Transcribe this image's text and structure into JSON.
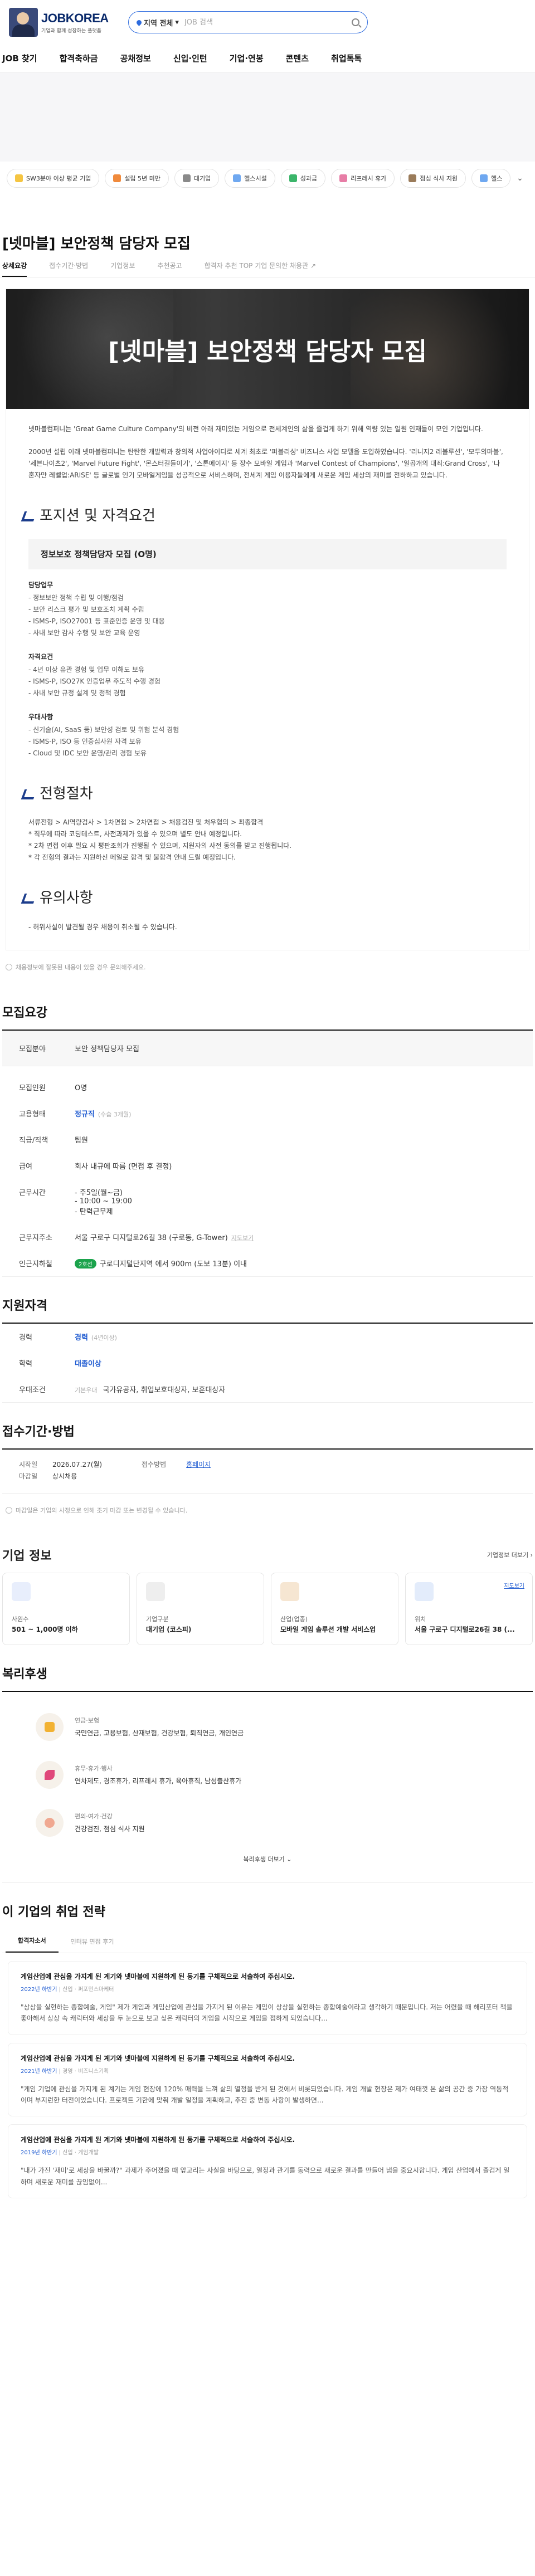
{
  "header": {
    "brand": "JOBKOREA",
    "tagline": "기업과 함께 성장하는 플랫폼",
    "search_location": "지역 전체",
    "search_placeholder": "JOB 검색"
  },
  "nav": [
    "JOB 찾기",
    "합격축하금",
    "공채정보",
    "신입·인턴",
    "기업·연봉",
    "콘텐츠",
    "취업톡톡"
  ],
  "pills": [
    "SW3분야 이상 평균 기업",
    "설립 5년 미만",
    "대기업",
    "헬스시설",
    "성과급",
    "리프레시 휴가",
    "점심 식사 지원",
    "헬스"
  ],
  "job": {
    "title": "[넷마블] 보안정책 담당자 모집",
    "tabs": [
      "상세요강",
      "접수기간·방법",
      "기업정보",
      "추천공고",
      "합격자 추천 TOP 기업 문의한 채용관"
    ],
    "poster": {
      "hero": "[넷마블] 보안정책 담당자 모집",
      "intro": "넷마블컴퍼니는 'Great Game Culture Company'의 비전 아래 재미있는 게임으로 전세계인의 삶을 즐겁게 하기 위해 역량 있는 일원 인재들이 모인 기업입니다.",
      "intro2": "2000년 설립 이래 넷마블컴퍼니는 탄탄한 개발력과 창의적 사업아이디로 세계 최초로 '퍼블리싱' 비즈니스 사업 모델을 도입하였습니다. '리니지2 레볼루션', '모두의마블', '세븐나이츠2', 'Marvel Future Fight', '몬스터길들이기', '스톤에이지' 등 장수 모바일 게임과 'Marvel Contest of Champions', '일곱개의 대죄:Grand Cross', '나 혼자만 레벨업:ARISE' 등 글로벌 인기 모바일게임을 성공적으로 서비스하며, 전세계 게임 이용자들에게 새로운 게임 세상의 재미를 전하하고 있습니다.",
      "sec1": "포지션 및 자격요건",
      "role": "정보보호 정책담당자 모집 (O명)",
      "duties_h": "담당업무",
      "duties": [
        "- 정보보안 정책 수립 및 이행/점검",
        "- 보안 리스크 평가 및 보호조치 계획 수립",
        "- ISMS-P, ISO27001 등 표준인증 운영 및 대응",
        "- 사내 보안 감사 수행 및 보안 교육 운영"
      ],
      "req_h": "자격요건",
      "req": [
        "- 4년 이상 유관 경험 및 업무 이해도 보유",
        "- ISMS-P, ISO27K 인증업무 주도적 수행 경험",
        "- 사내 보안 규정 설계 및 정책 경험"
      ],
      "pref_h": "우대사항",
      "pref": [
        "- 신기술(AI, SaaS 등) 보안성 검토 및 위험 분석 경험",
        "- ISMS-P, ISO 등 인증심사원 자격 보유",
        "- Cloud 및 IDC 보안 운영/관리 경험 보유"
      ],
      "sec2": "전형절차",
      "process": "서류전형 > AI역량검사 > 1차면접 > 2차면접 > 채용검진 및 처우협의 > 최종합격",
      "process_notes": [
        "* 직무에 따라 코딩테스트, 사전과제가 있을 수 있으며 별도 안내 예정입니다.",
        "* 2차 면접 이후 필요 시 평판조회가 진행될 수 있으며, 지원자의 사전 동의를 받고 진행됩니다.",
        "* 각 전형의 결과는 지원하신 메일로 합격 및 불합격 안내 드릴 예정입니다."
      ],
      "sec3": "유의사항",
      "notes": [
        "- 허위사실이 발견될 경우 채용이 취소될 수 있습니다."
      ]
    },
    "poster_note": "채용정보에 잘못된 내용이 있을 경우 문의해주세요."
  },
  "summary": {
    "title": "모집요강",
    "rows": [
      {
        "k": "모집분야",
        "v": "보안 정책담당자 모집"
      },
      {
        "k": "모집인원",
        "v": "O명"
      },
      {
        "k": "고용형태",
        "v": "정규직",
        "v2": "(수습 3개월)"
      },
      {
        "k": "직급/직책",
        "v": "팀원"
      },
      {
        "k": "급여",
        "v": "회사 내규에 따름 (면접 후 결정)"
      },
      {
        "k": "근무시간",
        "v": "- 주5일(월~금)",
        "v2": "- 10:00 ~ 19:00",
        "v3": "- 탄력근무제"
      },
      {
        "k": "근무지주소",
        "v": "서울 구로구 디지털로26길 38 (구로동, G-Tower)",
        "v2": "지도보기"
      },
      {
        "k": "인근지하철",
        "badge": "2호선",
        "v": "구로디지털단지역 에서 900m (도보 13분) 이내"
      }
    ]
  },
  "qual": {
    "title": "지원자격",
    "rows": [
      {
        "k": "경력",
        "v": "경력",
        "v2": "(4년이상)"
      },
      {
        "k": "학력",
        "v": "대졸이상"
      },
      {
        "k": "우대조건",
        "v0": "기본우대",
        "v": "국가유공자, 취업보호대상자, 보훈대상자"
      }
    ]
  },
  "period": {
    "title": "접수기간·방법",
    "start_label": "시작일",
    "start": "2026.07.27(월)",
    "end_label": "마감일",
    "end": "상시채용",
    "method_label": "접수방법",
    "method": "홈페이지",
    "note": "마감일은 기업의 사정으로 인해 조기 마감 또는 변경될 수 있습니다."
  },
  "company": {
    "title": "기업 정보",
    "link": "기업정보 더보기",
    "cards": [
      {
        "l": "사원수",
        "v": "501 ~ 1,000명 이하",
        "color": "#6a8cf0"
      },
      {
        "l": "기업구분",
        "v": "대기업 (코스피)",
        "color": "#8a8a8a"
      },
      {
        "l": "산업(업종)",
        "v": "모바일 게임 솔루션 개발 서비스업",
        "color": "#c07a2a"
      },
      {
        "l": "위치",
        "v": "서울 구로구 디지털로26길 38 (...",
        "link": "지도보기",
        "color": "#2d6bde"
      }
    ]
  },
  "welfare": {
    "title": "복리후생",
    "items": [
      {
        "t": "연금·보험",
        "d": "국민연금, 고용보험, 산재보험, 건강보험, 퇴직연금, 개인연금"
      },
      {
        "t": "휴무·휴가·행사",
        "d": "연차제도, 경조휴가, 리프레시 휴가, 육아휴직, 남성출산휴가"
      },
      {
        "t": "편의·여가·건강",
        "d": "건강검진, 점심 식사 지원"
      }
    ],
    "more": "복리후생 더보기"
  },
  "strategy": {
    "title": "이 기업의 취업 전략",
    "tabs": [
      "합격자소서",
      "인터뷰 면접 후기"
    ],
    "entries": [
      {
        "q": "게임산업에 관심을 가지게 된 계기와 넷마블에 지원하게 된 동기를 구체적으로 서술하여 주십시오.",
        "year": "2022년 하반기",
        "role": "신입 · 퍼포먼스마케터",
        "a": "\"상상을 실현하는 종합예술, 게임\" 제가 게임과 게임산업에 관심을 가지게 된 이유는 게임이 상상을 실현하는 종합예술이라고 생각하기 때문입니다. 저는 어렸을 때 해리포터 책을 좋아해서 상상 속 캐릭터와 세상을 두 눈으로 보고 싶은 캐릭터의 게임을 시작으로 게임을 접하게 되었습니다..."
      },
      {
        "q": "게임산업에 관심을 가지게 된 계기와 넷마블에 지원하게 된 동기를 구체적으로 서술하여 주십시오.",
        "year": "2021년 하반기",
        "role": "경영 · 비즈니스기획",
        "a": "\"게임 기업에 관심을 가지게 된 계기는 게임 현장에 120% 매력을 느껴 삶의 열정을 받게 된 것에서 비롯되었습니다. 게임 개발 현장은 제가 여태껏 본 삶의 공간 중 가장 역동적이며 부지런한 터전이었습니다. 프로젝트 기한에 맞춰 개발 일정을 계획하고, 추진 중 변동 사항이 발생하면..."
      },
      {
        "q": "게임산업에 관심을 가지게 된 계기와 넷마블에 지원하게 된 동기를 구체적으로 서술하여 주십시오.",
        "year": "2019년 하반기",
        "role": "신입 · 게임개발",
        "a": "\"내가 가진 '재미'로 세상을 바꿀까?\" 과제가 주어졌을 때 앞고리는 사실을 바탕으로, 열정과 관기를 동력으로 새로운 결과를 만들어 냄을 중요시합니다. 게임 산업에서 즐겁게 일하며 새로운 재미를 끊임없이..."
      }
    ]
  }
}
